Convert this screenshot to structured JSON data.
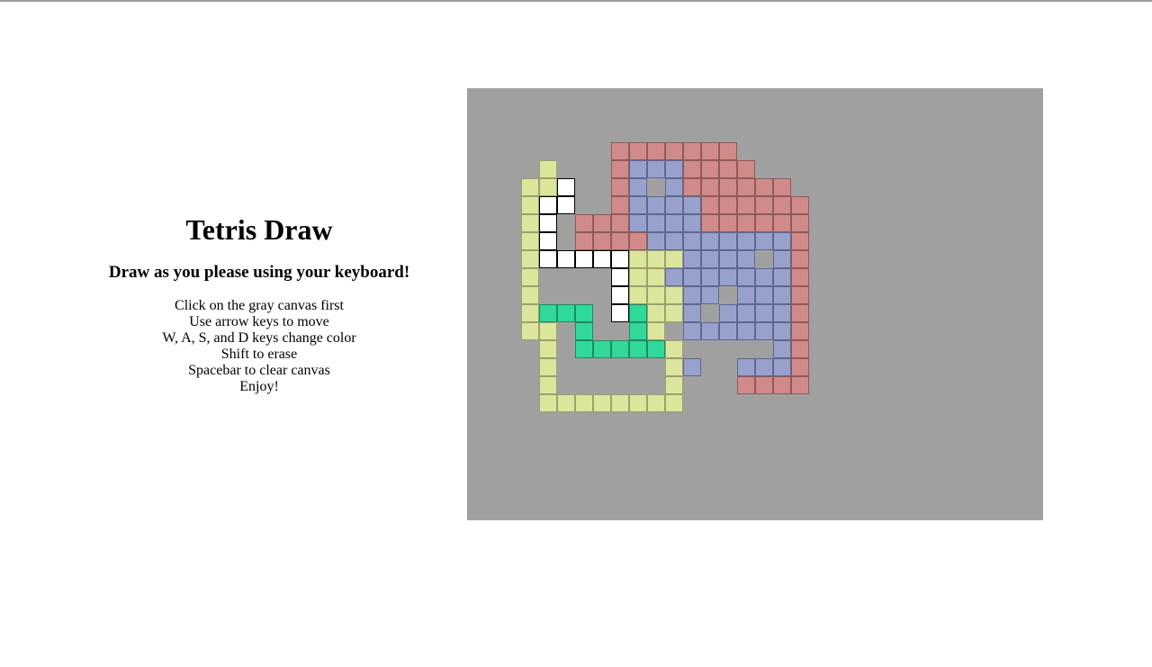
{
  "title": "Tetris Draw",
  "subtitle": "Draw as you please using your keyboard!",
  "instructions": [
    "Click on the gray canvas first",
    "Use arrow keys to move",
    "W, A, S, and D keys change color",
    "Shift to erase",
    "Spacebar to clear canvas",
    "Enjoy!"
  ],
  "canvas": {
    "background": "#a0a0a0",
    "grid_columns": 32,
    "grid_rows": 24,
    "palette": {
      "r": {
        "fill": "#d08a8a",
        "border": "#8e5a5a"
      },
      "b": {
        "fill": "#98a0cc",
        "border": "#5f6790"
      },
      "y": {
        "fill": "#dbe59c",
        "border": "#9aa070"
      },
      "g": {
        "fill": "#30d89a",
        "border": "#1d8a60"
      },
      "w": {
        "fill": "#ffffff",
        "border": "#000000"
      }
    },
    "rows": [
      "................................",
      "................................",
      "................................",
      "........rrrrrrr.................",
      "....y...rbbbrrrr................",
      "...yyw..rb.brrrrrr..............",
      "...yww..rbbbbrrrrrr.............",
      "...yw.rrrbbbbrrrrrr.............",
      "...yw.rrrrbbbbbbbbr.............",
      "...ywwwwwyyybbbb.br.............",
      "...y....wyybbbbbbbr.............",
      "...y....wyyybb.bbbr.............",
      "...yggg.wgyyb.bbbbr.............",
      "...yy.g..gy.bbbbbbr.............",
      "....y.gggggy.....br.............",
      "....y......yb..bbbr.............",
      "....y......y...rrrr.............",
      "....yyyyyyyy...................."
    ]
  }
}
